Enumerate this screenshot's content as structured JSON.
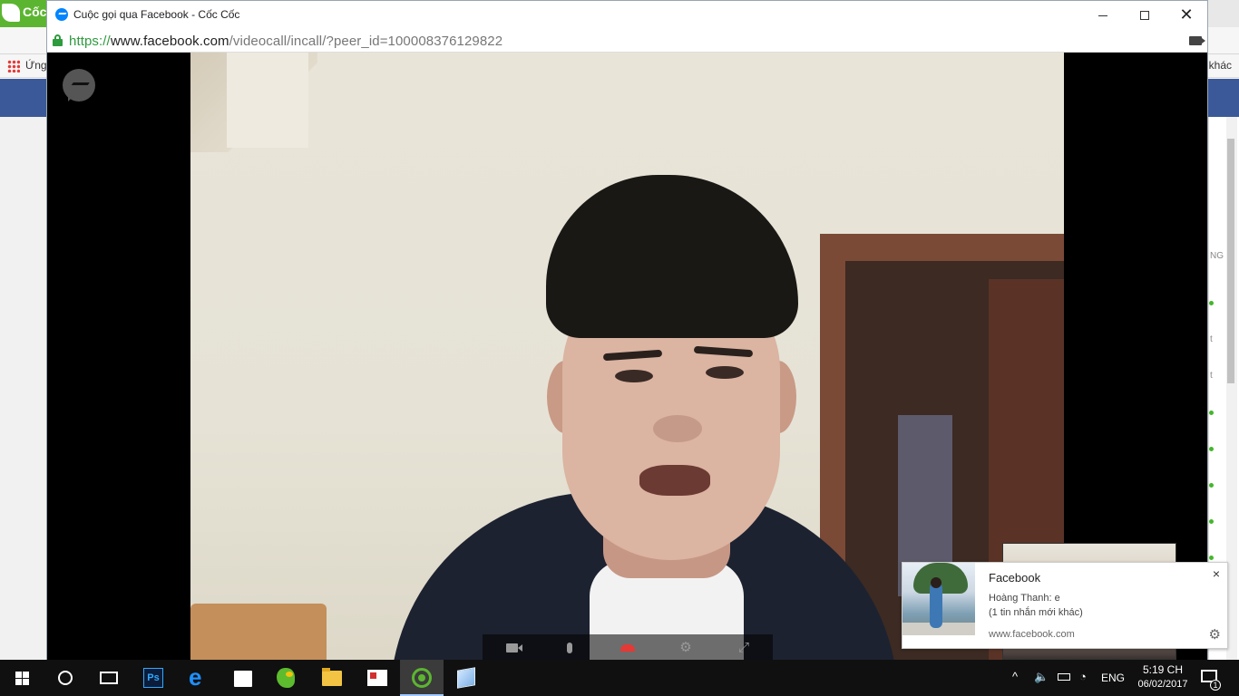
{
  "background_browser": {
    "logo_text": "Cốc",
    "bookmarks_apps_label": "Ứng",
    "bookmarks_other_label": "khác",
    "right_panel_letters": [
      "NG",
      "t",
      "t"
    ]
  },
  "popup": {
    "title": "Cuộc gọi qua Facebook - Cốc Cốc",
    "url_protocol": "https://",
    "url_host": "www.facebook.com",
    "url_path": "/videocall/incall/?peer_id=100008376129822",
    "controls": {
      "camera": "camera-icon",
      "mic": "microphone-icon",
      "end_call": "end-call-icon",
      "settings": "gear-icon",
      "fullscreen": "expand-icon",
      "end_call_color": "#e53935"
    }
  },
  "toast": {
    "app_name": "Facebook",
    "line1": "Hoàng Thanh: e",
    "line2": "(1 tin nhắn mới khác)",
    "site": "www.facebook.com",
    "close_label": "×",
    "gear_label": "⚙"
  },
  "taskbar": {
    "apps": [
      "start",
      "cortana",
      "task-view",
      "photoshop",
      "edge",
      "store",
      "bird-app",
      "file-explorer",
      "presentation-app",
      "coccoc",
      "cube-app"
    ],
    "photoshop_label": "Ps",
    "edge_label": "e",
    "tray": {
      "language": "ENG",
      "time": "5:19 CH",
      "date": "06/02/2017",
      "notification_count": "1"
    }
  },
  "colors": {
    "facebook_blue": "#3b5998",
    "messenger_blue": "#0084ff",
    "coccoc_green": "#5cb531",
    "secure_green": "#2e9b3e"
  }
}
